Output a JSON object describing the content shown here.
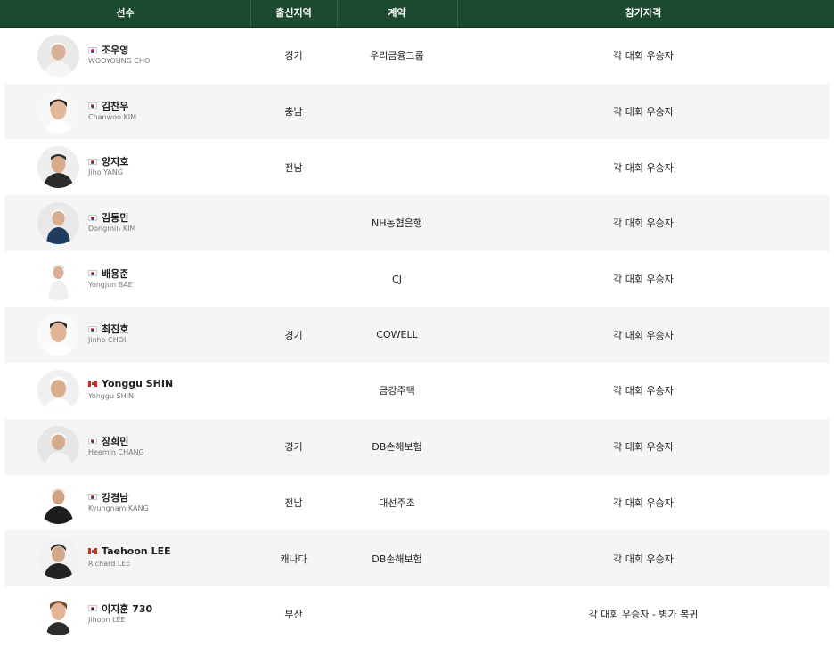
{
  "table": {
    "columns": {
      "player": "선수",
      "region": "출신지역",
      "sponsor": "계약",
      "qualification": "참가자격"
    },
    "rows": [
      {
        "flag": "kr",
        "name": "조우영",
        "name_en": "WOOYOUNG CHO",
        "region": "경기",
        "sponsor": "우리금융그룹",
        "qualification": "각 대회 우승자"
      },
      {
        "flag": "kr",
        "name": "김찬우",
        "name_en": "Chanwoo KIM",
        "region": "충남",
        "sponsor": "",
        "qualification": "각 대회 우승자"
      },
      {
        "flag": "kr",
        "name": "양지호",
        "name_en": "Jiho YANG",
        "region": "전남",
        "sponsor": "",
        "qualification": "각 대회 우승자"
      },
      {
        "flag": "kr",
        "name": "김동민",
        "name_en": "Dongmin KIM",
        "region": "",
        "sponsor": "NH농협은행",
        "qualification": "각 대회 우승자"
      },
      {
        "flag": "kr",
        "name": "배용준",
        "name_en": "Yongjun BAE",
        "region": "",
        "sponsor": "CJ",
        "qualification": "각 대회 우승자"
      },
      {
        "flag": "kr",
        "name": "최진호",
        "name_en": "Jinho CHOI",
        "region": "경기",
        "sponsor": "COWELL",
        "qualification": "각 대회 우승자"
      },
      {
        "flag": "ca",
        "name": "Yonggu SHIN",
        "name_en": "Yonggu SHIN",
        "region": "",
        "sponsor": "금강주택",
        "qualification": "각 대회 우승자"
      },
      {
        "flag": "kr",
        "name": "장희민",
        "name_en": "Heemin CHANG",
        "region": "경기",
        "sponsor": "DB손해보험",
        "qualification": "각 대회 우승자"
      },
      {
        "flag": "kr",
        "name": "강경남",
        "name_en": "Kyungnam KANG",
        "region": "전남",
        "sponsor": "대선주조",
        "qualification": "각 대회 우승자"
      },
      {
        "flag": "ca",
        "name": "Taehoon LEE",
        "name_en": "Richard LEE",
        "region": "캐나다",
        "sponsor": "DB손해보험",
        "qualification": "각 대회 우승자"
      },
      {
        "flag": "kr",
        "name": "이지훈 730",
        "name_en": "Jihoon LEE",
        "region": "부산",
        "sponsor": "",
        "qualification": "각 대회 우승자 - 병가 복귀"
      }
    ]
  }
}
